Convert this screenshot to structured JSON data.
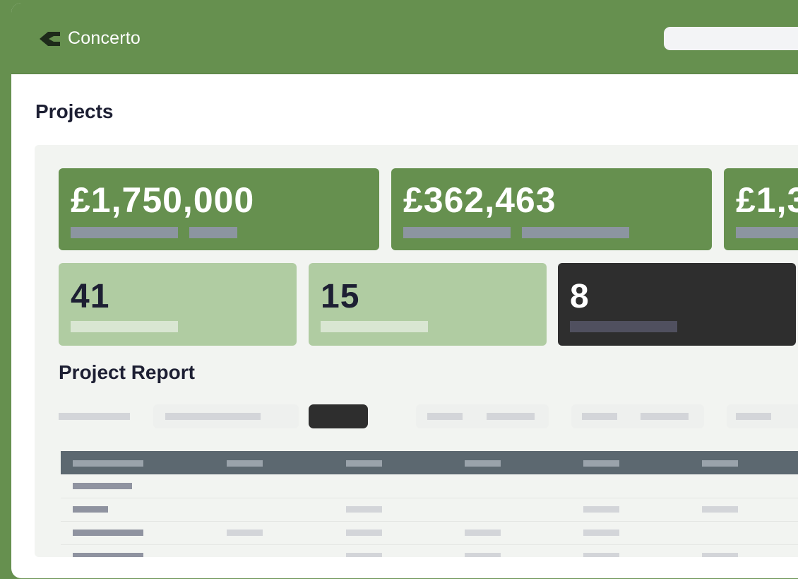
{
  "app": {
    "name": "Concerto"
  },
  "page": {
    "title": "Projects"
  },
  "summary_cards": [
    {
      "value": "£1,750,000"
    },
    {
      "value": "£362,463"
    },
    {
      "value": "£1,3"
    }
  ],
  "count_cards": [
    {
      "value": "41"
    },
    {
      "value": "15"
    },
    {
      "value": "8"
    }
  ],
  "report": {
    "title": "Project Report"
  },
  "colors": {
    "brand_green": "#66904f",
    "light_green": "#b0cca2",
    "dark": "#2e2e2e",
    "table_header": "#5c6870"
  },
  "icons": {
    "logo": "concerto-logo-icon"
  }
}
